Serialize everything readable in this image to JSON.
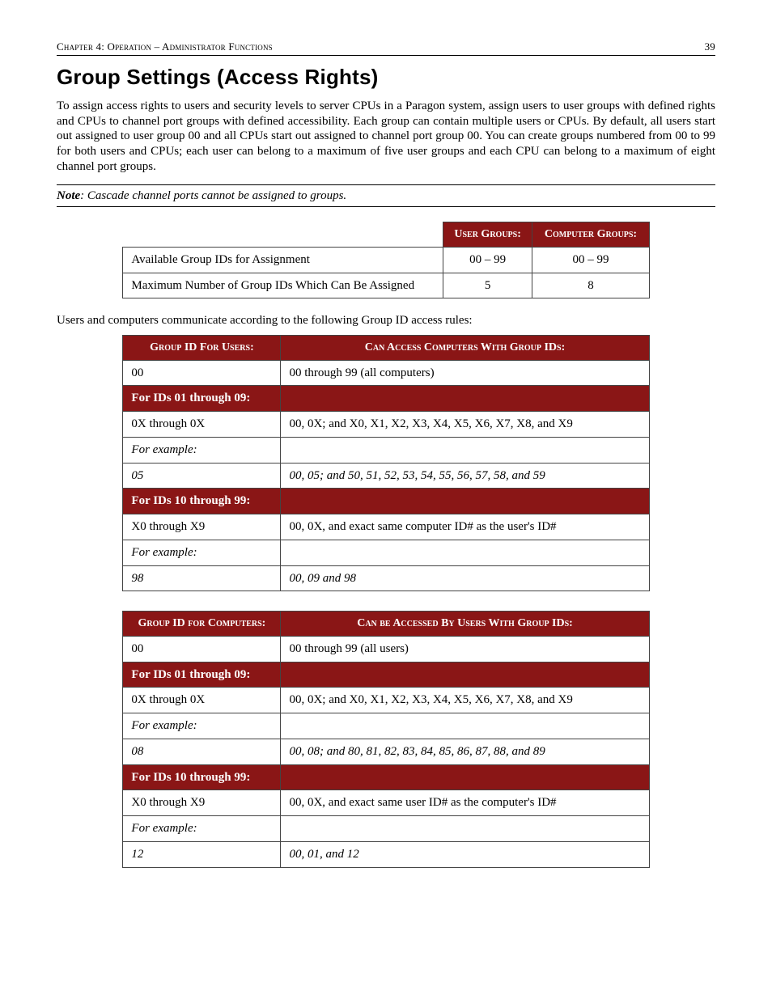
{
  "header": {
    "chapter_line": "Chapter 4: Operation – Administrator Functions",
    "page_number": "39"
  },
  "title": "Group Settings (Access Rights)",
  "paragraph1": "To assign access rights to users and security levels to server CPUs in a Paragon system, assign users to user groups with defined rights and CPUs to channel port groups with defined accessibility. Each group can contain multiple users or CPUs.  By default, all users start out assigned to user group 00 and all CPUs start out assigned to channel port group 00. You can create groups numbered from 00 to 99 for both users and CPUs; each user can belong to a maximum of five user groups and each CPU can belong to a maximum of eight channel port groups.",
  "note": {
    "label": "Note",
    "text": ": Cascade channel ports cannot be assigned to groups."
  },
  "summary_table": {
    "headers": {
      "blank": "",
      "user": "User Groups:",
      "computer": "Computer Groups:"
    },
    "rows": [
      {
        "label": "Available Group IDs for Assignment",
        "user": "00 – 99",
        "computer": "00 – 99"
      },
      {
        "label": "Maximum Number of Group IDs Which Can Be Assigned",
        "user": "5",
        "computer": "8"
      }
    ]
  },
  "intro2": "Users and computers communicate according to the following Group ID access rules:",
  "table_users": {
    "headers": {
      "left": "Group  ID For Users:",
      "right": "Can Access Computers With Group IDs:"
    },
    "rows": [
      {
        "type": "data",
        "left": "00",
        "right": "00 through 99  (all computers)"
      },
      {
        "type": "section",
        "left": "For IDs 01 through 09:",
        "right": ""
      },
      {
        "type": "data",
        "left": "0X through 0X",
        "right": "00, 0X; and X0, X1, X2, X3, X4, X5, X6, X7, X8, and X9"
      },
      {
        "type": "italic",
        "left": "For example:",
        "right": ""
      },
      {
        "type": "italic",
        "left": "05",
        "right": "00, 05; and 50, 51, 52, 53, 54, 55, 56, 57, 58, and 59"
      },
      {
        "type": "section",
        "left": "For IDs 10 through 99:",
        "right": ""
      },
      {
        "type": "data",
        "left": "X0 through X9",
        "right": "00, 0X, and exact same computer ID# as the user's ID#"
      },
      {
        "type": "italic",
        "left": "For example:",
        "right": ""
      },
      {
        "type": "italic",
        "left": "98",
        "right": "00, 09 and 98"
      }
    ]
  },
  "table_computers": {
    "headers": {
      "left": "Group ID for Computers:",
      "right": "Can be Accessed By Users With Group IDs:"
    },
    "rows": [
      {
        "type": "data",
        "left": "00",
        "right": "00 through 99 (all users)"
      },
      {
        "type": "section",
        "left": "For IDs 01 through 09:",
        "right": ""
      },
      {
        "type": "data",
        "left": "0X through 0X",
        "right": "00, 0X; and X0, X1, X2, X3, X4, X5, X6, X7, X8, and X9"
      },
      {
        "type": "italic",
        "left": "For example:",
        "right": ""
      },
      {
        "type": "italic",
        "left": "08",
        "right": "00, 08; and 80, 81, 82, 83, 84, 85, 86, 87, 88, and 89"
      },
      {
        "type": "section",
        "left": "For IDs 10 through 99:",
        "right": ""
      },
      {
        "type": "data",
        "left": "X0 through X9",
        "right": "00, 0X, and exact same user ID# as the computer's ID#"
      },
      {
        "type": "italic",
        "left": "For example:",
        "right": ""
      },
      {
        "type": "italic",
        "left": "12",
        "right": "00, 01, and 12"
      }
    ]
  }
}
